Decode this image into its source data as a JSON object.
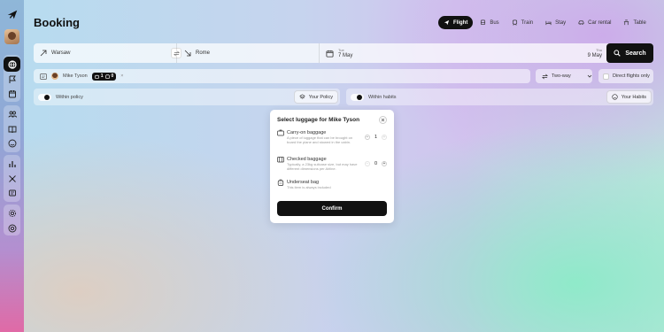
{
  "page": {
    "title": "Booking"
  },
  "modes": [
    {
      "label": "Flight",
      "icon": "plane-icon",
      "active": true
    },
    {
      "label": "Bus",
      "icon": "bus-icon",
      "active": false
    },
    {
      "label": "Train",
      "icon": "train-icon",
      "active": false
    },
    {
      "label": "Stay",
      "icon": "bed-icon",
      "active": false
    },
    {
      "label": "Car rental",
      "icon": "car-icon",
      "active": false
    },
    {
      "label": "Table",
      "icon": "table-icon",
      "active": false
    }
  ],
  "search": {
    "origin": "Warsaw",
    "destination": "Rome",
    "depart": {
      "weekday": "Tue",
      "date": "7 May"
    },
    "return": {
      "weekday": "Thu",
      "date": "9 May"
    },
    "button_label": "Search"
  },
  "passengers": {
    "name": "Mike Tyson",
    "carry_on_count": "1",
    "checked_count": "0",
    "remove_label": "×"
  },
  "trip_type": "Two-way",
  "direct_flights": {
    "label": "Direct flights only",
    "checked": false
  },
  "policy": {
    "within_policy_label": "Within policy",
    "your_policy_label": "Your Policy",
    "within_habits_label": "Within habits",
    "your_habits_label": "Your Habits"
  },
  "luggage_modal": {
    "title": "Select luggage for Mike Tyson",
    "items": [
      {
        "name": "Carry-on baggage",
        "description": "A piece of luggage that can be brought on board the plane and stowed in the cabin.",
        "count": "1",
        "icon": "briefcase-icon"
      },
      {
        "name": "Checked baggage",
        "description": "Typically, a 23kg suitcase size, but may have different dimensions per Airline.",
        "count": "0",
        "icon": "suitcase-icon"
      },
      {
        "name": "Underseat bag",
        "description": "This item is always included",
        "count": "",
        "icon": "backpack-icon"
      }
    ],
    "confirm_label": "Confirm"
  },
  "colors": {
    "accent": "#111111",
    "modal_bg": "#ffffff"
  }
}
